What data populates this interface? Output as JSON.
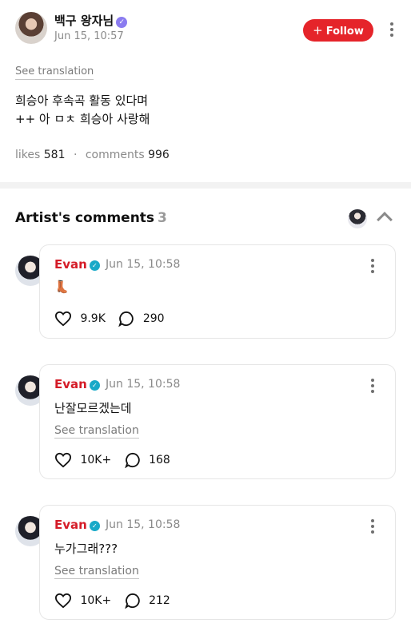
{
  "post": {
    "author": "백구 왕자님",
    "time": "Jun 15, 10:57",
    "follow_label": "Follow",
    "see_translation": "See translation",
    "body": "희승아 후속곡 활동 있다며\n++ 아 ㅁㅊ 희승아 사랑해",
    "likes_label": "likes",
    "likes": "581",
    "comments_label": "comments",
    "comments": "996"
  },
  "artist_comments": {
    "title": "Artist's comments",
    "count": "3",
    "items": [
      {
        "name": "Evan",
        "time": "Jun 15, 10:58",
        "text": "👢",
        "see_translation": "",
        "likes": "9.9K",
        "replies": "290"
      },
      {
        "name": "Evan",
        "time": "Jun 15, 10:58",
        "text": "난잘모르겠는데",
        "see_translation": "See translation",
        "likes": "10K+",
        "replies": "168"
      },
      {
        "name": "Evan",
        "time": "Jun 15, 10:58",
        "text": "누가그래???",
        "see_translation": "See translation",
        "likes": "10K+",
        "replies": "212"
      }
    ]
  },
  "colors": {
    "follow": "#e5242a",
    "artist_name": "#d51c28",
    "verified": "#18a9c8"
  },
  "icons": [
    "verified-badge-icon",
    "plus-icon",
    "more-vertical-icon",
    "chevron-up-icon",
    "heart-icon",
    "comment-bubble-icon"
  ]
}
